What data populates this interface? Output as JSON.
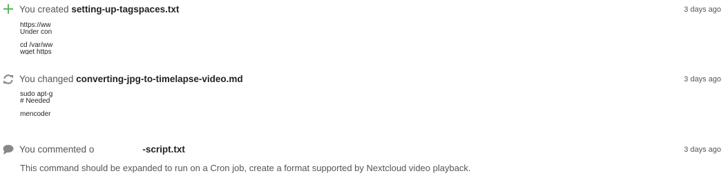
{
  "activities": [
    {
      "icon": "plus-icon",
      "action_text": "You created ",
      "file_name": "setting-up-tagspaces.txt",
      "time": "3 days ago",
      "preview_lines": [
        "https://ww",
        "Under con",
        "",
        "cd /var/ww",
        "wget https"
      ]
    },
    {
      "icon": "sync-icon",
      "action_text": "You changed ",
      "file_name": "converting-jpg-to-timelapse-video.md",
      "time": "3 days ago",
      "preview_lines": [
        "sudo apt-g",
        "# Needed",
        "",
        "mencoder"
      ]
    },
    {
      "icon": "comment-icon",
      "action_text": "You commented o",
      "file_name": "-script.txt",
      "time": "3 days ago",
      "comment": "This command should be expanded to run on a Cron job, create a format supported by Nextcloud video playback."
    }
  ],
  "colors": {
    "created_icon": "#5cb85c",
    "changed_icon": "#888888",
    "comment_icon": "#888888",
    "file_name": "#222222",
    "text": "#555555"
  }
}
